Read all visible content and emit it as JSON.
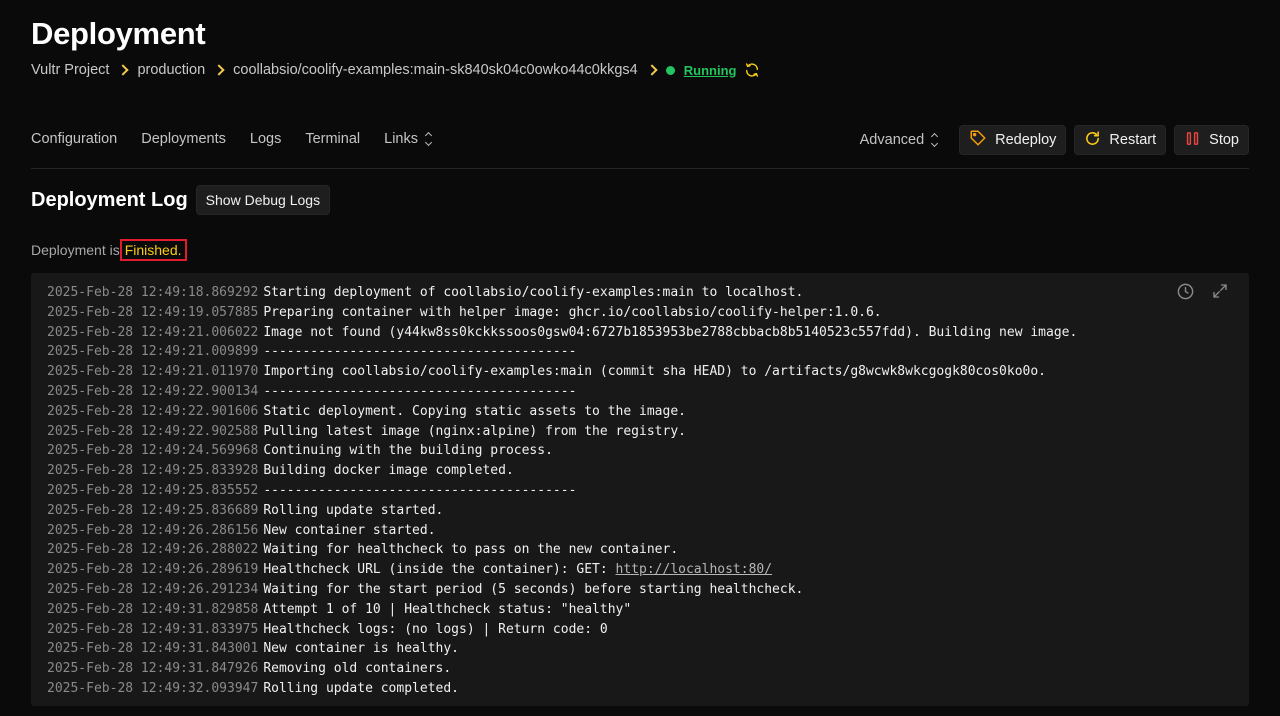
{
  "header": {
    "title": "Deployment",
    "breadcrumb": {
      "project": "Vultr Project",
      "environment": "production",
      "resource": "coollabsio/coolify-examples:main-sk840sk04c0owko44c0kkgs4",
      "status": "Running"
    }
  },
  "nav": {
    "items": [
      "Configuration",
      "Deployments",
      "Logs",
      "Terminal",
      "Links"
    ],
    "advanced": "Advanced",
    "redeploy": "Redeploy",
    "restart": "Restart",
    "stop": "Stop"
  },
  "log": {
    "title": "Deployment Log",
    "debug_button": "Show Debug Logs",
    "status_prefix": "Deployment is",
    "status_value": "Finished.",
    "lines": [
      {
        "ts": "2025-Feb-28 12:49:18.869292",
        "msg": "Starting deployment of coollabsio/coolify-examples:main to localhost."
      },
      {
        "ts": "2025-Feb-28 12:49:19.057885",
        "msg": "Preparing container with helper image: ghcr.io/coollabsio/coolify-helper:1.0.6."
      },
      {
        "ts": "2025-Feb-28 12:49:21.006022",
        "msg": "Image not found (y44kw8ss0kckkssoos0gsw04:6727b1853953be2788cbbacb8b5140523c557fdd). Building new image."
      },
      {
        "ts": "2025-Feb-28 12:49:21.009899",
        "msg": "----------------------------------------"
      },
      {
        "ts": "2025-Feb-28 12:49:21.011970",
        "msg": "Importing coollabsio/coolify-examples:main (commit sha HEAD) to /artifacts/g8wcwk8wkcgogk80cos0ko0o."
      },
      {
        "ts": "2025-Feb-28 12:49:22.900134",
        "msg": "----------------------------------------"
      },
      {
        "ts": "2025-Feb-28 12:49:22.901606",
        "msg": "Static deployment. Copying static assets to the image."
      },
      {
        "ts": "2025-Feb-28 12:49:22.902588",
        "msg": "Pulling latest image (nginx:alpine) from the registry."
      },
      {
        "ts": "2025-Feb-28 12:49:24.569968",
        "msg": "Continuing with the building process."
      },
      {
        "ts": "2025-Feb-28 12:49:25.833928",
        "msg": "Building docker image completed."
      },
      {
        "ts": "2025-Feb-28 12:49:25.835552",
        "msg": "----------------------------------------"
      },
      {
        "ts": "2025-Feb-28 12:49:25.836689",
        "msg": "Rolling update started."
      },
      {
        "ts": "2025-Feb-28 12:49:26.286156",
        "msg": "New container started."
      },
      {
        "ts": "2025-Feb-28 12:49:26.288022",
        "msg": "Waiting for healthcheck to pass on the new container."
      },
      {
        "ts": "2025-Feb-28 12:49:26.289619",
        "msg": "Healthcheck URL (inside the container): GET: ",
        "link": "http://localhost:80/"
      },
      {
        "ts": "2025-Feb-28 12:49:26.291234",
        "msg": "Waiting for the start period (5 seconds) before starting healthcheck."
      },
      {
        "ts": "2025-Feb-28 12:49:31.829858",
        "msg": "Attempt 1 of 10 | Healthcheck status: \"healthy\""
      },
      {
        "ts": "2025-Feb-28 12:49:31.833975",
        "msg": "Healthcheck logs: (no logs) | Return code: 0"
      },
      {
        "ts": "2025-Feb-28 12:49:31.843001",
        "msg": "New container is healthy."
      },
      {
        "ts": "2025-Feb-28 12:49:31.847926",
        "msg": "Removing old containers."
      },
      {
        "ts": "2025-Feb-28 12:49:32.093947",
        "msg": "Rolling update completed."
      }
    ]
  },
  "colors": {
    "accent": "#facc15",
    "status_running": "#22c55e",
    "stop_red": "#ef4444",
    "highlight_border": "#e11d2d"
  },
  "icons": {
    "redeploy": "tag-icon",
    "restart": "restart-icon",
    "stop": "stop-icon",
    "refresh": "refresh-icon",
    "history": "clock-icon",
    "fullscreen": "expand-icon"
  }
}
